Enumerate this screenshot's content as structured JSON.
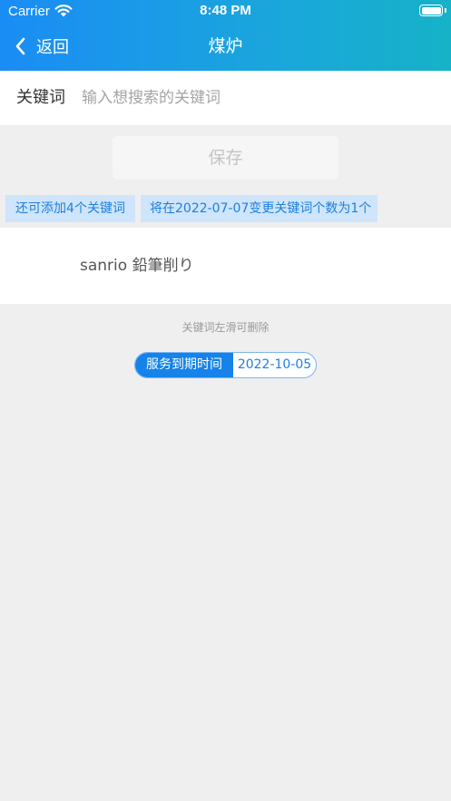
{
  "status_bar": {
    "carrier": "Carrier",
    "time": "8:48 PM"
  },
  "nav": {
    "back_label": "返回",
    "title": "煤炉"
  },
  "keyword_form": {
    "label": "关键词",
    "placeholder": "输入想搜索的关键词",
    "value": ""
  },
  "save_button": {
    "label": "保存"
  },
  "info_tags": {
    "remaining": "还可添加4个关键词",
    "change_notice": "将在2022-07-07变更关键词个数为1个"
  },
  "keywords": [
    "sanrio 鉛筆削り"
  ],
  "hint": "关键词左滑可删除",
  "expiry": {
    "label": "服务到期时间",
    "date": "2022-10-05"
  },
  "colors": {
    "header_start": "#1a8cf5",
    "header_end": "#16b2c8",
    "accent": "#1583ea",
    "tag_bg": "#cfe5fb",
    "background": "#efefef"
  }
}
